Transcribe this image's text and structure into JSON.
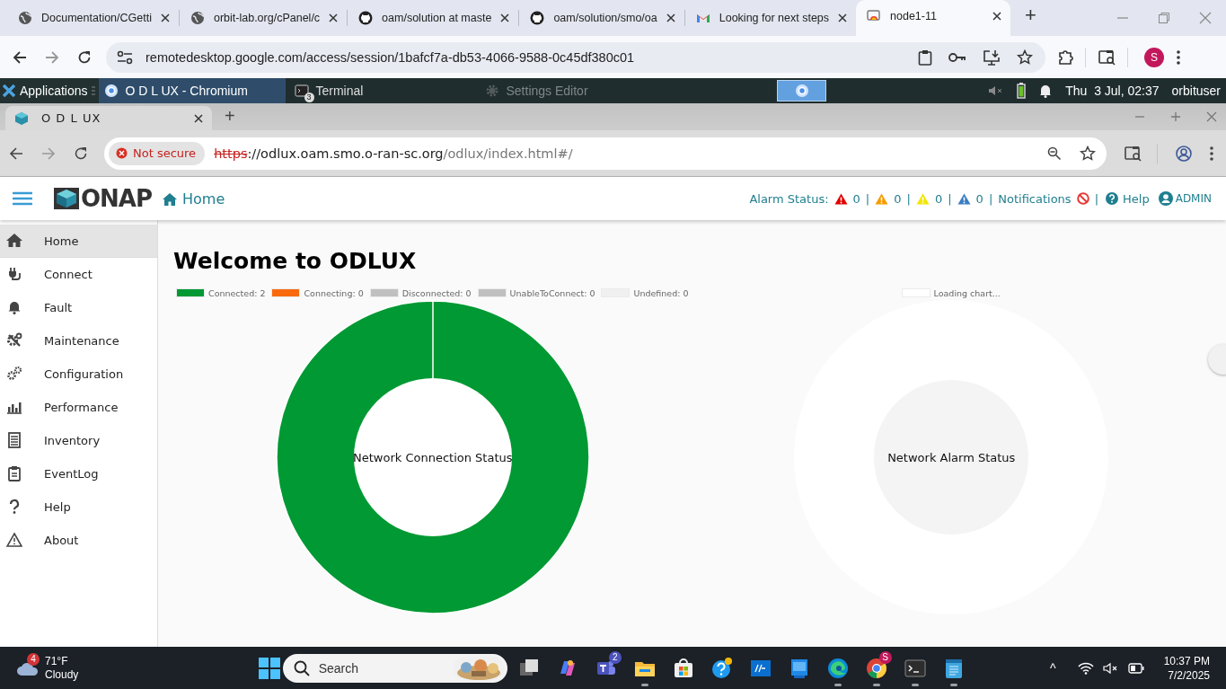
{
  "browser": {
    "tabs": [
      {
        "title": "Documentation/CGetti",
        "kind": "globe",
        "selected": false
      },
      {
        "title": "orbit-lab.org/cPanel/c",
        "kind": "globe",
        "selected": false
      },
      {
        "title": "oam/solution at maste",
        "kind": "github",
        "selected": false
      },
      {
        "title": "oam/solution/smo/oa",
        "kind": "github",
        "selected": false
      },
      {
        "title": "Looking for next steps",
        "kind": "mail",
        "selected": false
      },
      {
        "title": "node1-11",
        "kind": "remote",
        "selected": true
      }
    ],
    "new_tab": "+",
    "address": "remotedesktop.google.com/access/session/1bafcf7a-db53-4066-9588-0c45df380c01",
    "profile": "S"
  },
  "desktop_panel": {
    "menu": "Applications",
    "windows": [
      {
        "title": "O D L UX - Chromium",
        "kind": "chromium",
        "selected": true,
        "minimized": false
      },
      {
        "title": "Terminal",
        "kind": "terminal",
        "badge": "3",
        "selected": false,
        "minimized": false
      },
      {
        "title": "Settings Editor",
        "kind": "settings",
        "selected": false,
        "minimized": true
      }
    ],
    "clock": "Thu  3 Jul, 02:37",
    "user": "orbituser"
  },
  "inner_browser": {
    "tab_title": "O D L UX",
    "new_tab": "+",
    "security_chip": "Not secure",
    "url": {
      "scheme": "https",
      "host": "://odlux.oam.smo.o-ran-sc.org",
      "path": "/odlux/index.html#/"
    }
  },
  "app_header": {
    "logo": "ONAP",
    "page": "Home",
    "alarm_label": "Alarm Status:",
    "alarms": [
      {
        "count": "0",
        "separator": "|",
        "color": "#e00000"
      },
      {
        "count": "0",
        "separator": "|",
        "color": "#f59b00"
      },
      {
        "count": "0",
        "separator": "|",
        "color": "#f2e600"
      },
      {
        "count": "0",
        "separator": "|",
        "color": "#3b7dc4"
      }
    ],
    "notifications": "Notifications",
    "notifications_separator": "|",
    "help": "Help",
    "user": "ADMIN"
  },
  "sidebar": {
    "items": [
      {
        "label": "Home",
        "selected": true
      },
      {
        "label": "Connect",
        "selected": false
      },
      {
        "label": "Fault",
        "selected": false
      },
      {
        "label": "Maintenance",
        "selected": false
      },
      {
        "label": "Configuration",
        "selected": false
      },
      {
        "label": "Performance",
        "selected": false
      },
      {
        "label": "Inventory",
        "selected": false
      },
      {
        "label": "EventLog",
        "selected": false
      },
      {
        "label": "Help",
        "selected": false
      },
      {
        "label": "About",
        "selected": false
      }
    ]
  },
  "main": {
    "title": "Welcome to ODLUX",
    "connection_chart": {
      "legend": [
        {
          "color": "#009933"
        },
        {
          "color": "#f96a0e"
        },
        {
          "color": "#c0c0c0"
        },
        {
          "color": "#c0c0c0"
        },
        {
          "color": "#f0f0f0"
        }
      ],
      "chart_data": {
        "type": "donut",
        "title": "Network Connection Status",
        "categories": [
          "Connected: 2",
          "Connecting: 0",
          "Disconnected: 0",
          "UnableToConnect: 0",
          "Undefined: 0"
        ],
        "values": [
          100,
          0,
          0,
          0,
          0
        ]
      }
    },
    "alarm_chart": {
      "legend": [
        {
          "label": "Loading chart...",
          "color": "#ffffff"
        }
      ],
      "title": "Network Alarm Status"
    }
  },
  "taskbar": {
    "weather": {
      "badge": "4",
      "temperature": "71°F",
      "condition": "Cloudy"
    },
    "search": {
      "placeholder": "Search"
    },
    "apps": [
      {
        "kind": "taskview",
        "running": false
      },
      {
        "kind": "copilot",
        "running": false
      },
      {
        "kind": "teams",
        "badge": "2",
        "running": false
      },
      {
        "kind": "files",
        "running": true
      },
      {
        "kind": "store",
        "running": false
      },
      {
        "kind": "help",
        "running": false
      },
      {
        "kind": "hp",
        "running": false
      },
      {
        "kind": "monitor",
        "running": false
      },
      {
        "kind": "edge",
        "running": true
      },
      {
        "kind": "chrome",
        "badge": "S",
        "running": true
      },
      {
        "kind": "terminal",
        "running": true
      },
      {
        "kind": "notepad",
        "running": true
      }
    ],
    "overflow": "^",
    "time": "10:37 PM",
    "date": "7/2/2025"
  }
}
